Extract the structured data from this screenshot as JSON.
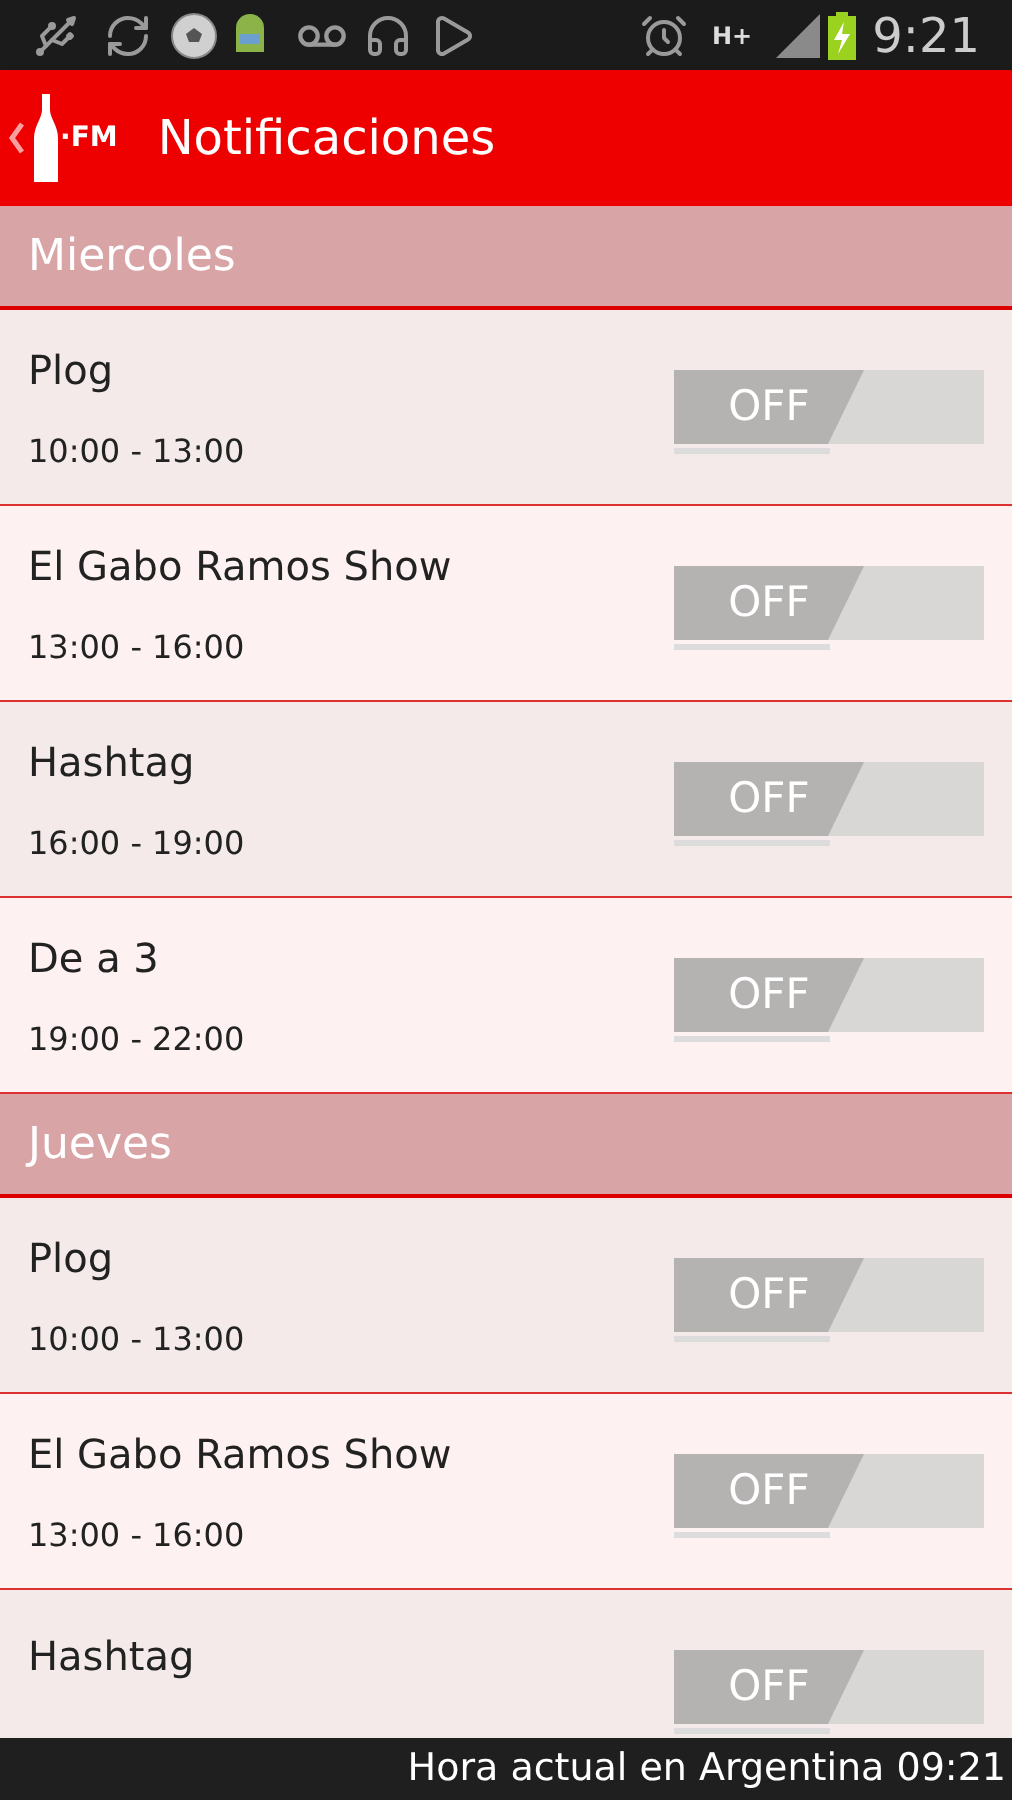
{
  "status_bar": {
    "network": "H+",
    "time": "9:21"
  },
  "app_bar": {
    "logo_text": "·FM",
    "title": "Notificaciones"
  },
  "sections": [
    {
      "day": "Miercoles",
      "shows": [
        {
          "name": "Plog",
          "time": "10:00 - 13:00",
          "toggle": {
            "label": "OFF",
            "on": false
          }
        },
        {
          "name": "El Gabo Ramos Show",
          "time": "13:00 - 16:00",
          "toggle": {
            "label": "OFF",
            "on": false
          }
        },
        {
          "name": "Hashtag",
          "time": "16:00 - 19:00",
          "toggle": {
            "label": "OFF",
            "on": false
          }
        },
        {
          "name": "De a 3",
          "time": "19:00 - 22:00",
          "toggle": {
            "label": "OFF",
            "on": false
          }
        }
      ]
    },
    {
      "day": "Jueves",
      "shows": [
        {
          "name": "Plog",
          "time": "10:00 - 13:00",
          "toggle": {
            "label": "OFF",
            "on": false
          }
        },
        {
          "name": "El Gabo Ramos Show",
          "time": "13:00 - 16:00",
          "toggle": {
            "label": "OFF",
            "on": false
          }
        },
        {
          "name": "Hashtag",
          "toggle": {
            "label": "OFF",
            "on": false
          }
        }
      ]
    }
  ],
  "footer": {
    "text": "Hora actual en Argentina 09:21"
  }
}
